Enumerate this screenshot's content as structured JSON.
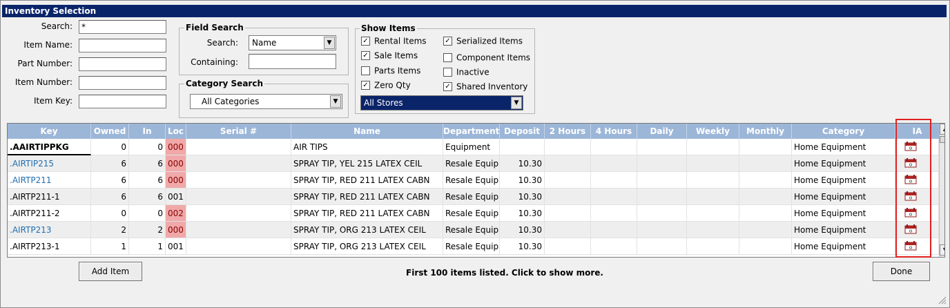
{
  "window": {
    "title": "Inventory Selection"
  },
  "search_fields": {
    "search_label": "Search:",
    "search_value": "*",
    "item_name_label": "Item Name:",
    "item_name_value": "",
    "part_number_label": "Part Number:",
    "part_number_value": "",
    "item_number_label": "Item Number:",
    "item_number_value": "",
    "item_key_label": "Item Key:",
    "item_key_value": ""
  },
  "field_search": {
    "title": "Field Search",
    "search_label": "Search:",
    "search_value": "Name",
    "containing_label": "Containing:",
    "containing_value": ""
  },
  "category_search": {
    "title": "Category Search",
    "value": "All Categories"
  },
  "show_items": {
    "title": "Show Items",
    "options": [
      {
        "label": "Rental Items",
        "checked": true
      },
      {
        "label": "Sale Items",
        "checked": true
      },
      {
        "label": "Parts Items",
        "checked": false
      },
      {
        "label": "Zero Qty",
        "checked": true
      },
      {
        "label": "Serialized Items",
        "checked": true
      },
      {
        "label": "Component Items",
        "checked": false
      },
      {
        "label": "Inactive",
        "checked": false
      },
      {
        "label": "Shared Inventory",
        "checked": true
      }
    ],
    "store_value": "All Stores"
  },
  "grid": {
    "columns": [
      "Key",
      "Owned",
      "In",
      "Loc",
      "Serial #",
      "Name",
      "Department",
      "Deposit",
      "2 Hours",
      "4 Hours",
      "Daily",
      "Weekly",
      "Monthly",
      "Category",
      "IA"
    ],
    "rows": [
      {
        "key": ".AAIRTIPPKG",
        "owned": "0",
        "in": "0",
        "loc": "000",
        "serial": "",
        "name": "AIR TIPS",
        "department": "Equipment",
        "deposit": "",
        "h2": "",
        "h4": "",
        "daily": "",
        "weekly": "",
        "monthly": "",
        "category": "Home Equipment",
        "ia": "calendar-icon"
      },
      {
        "key": ".AIRTIP215",
        "owned": "6",
        "in": "6",
        "loc": "000",
        "serial": "",
        "name": "SPRAY TIP, YEL 215 LATEX CEIL",
        "department": "Resale Equipr",
        "deposit": "10.30",
        "h2": "",
        "h4": "",
        "daily": "",
        "weekly": "",
        "monthly": "",
        "category": "Home Equipment",
        "ia": "calendar-icon"
      },
      {
        "key": ".AIRTP211",
        "owned": "6",
        "in": "6",
        "loc": "000",
        "serial": "",
        "name": "SPRAY TIP, RED 211 LATEX CABN",
        "department": "Resale Equipr",
        "deposit": "10.30",
        "h2": "",
        "h4": "",
        "daily": "",
        "weekly": "",
        "monthly": "",
        "category": "Home Equipment",
        "ia": "calendar-icon"
      },
      {
        "key": ".AIRTP211-1",
        "owned": "6",
        "in": "6",
        "loc": "001",
        "serial": "",
        "name": "SPRAY TIP, RED 211 LATEX CABN",
        "department": "Resale Equipr",
        "deposit": "10.30",
        "h2": "",
        "h4": "",
        "daily": "",
        "weekly": "",
        "monthly": "",
        "category": "Home Equipment",
        "ia": "calendar-icon"
      },
      {
        "key": ".AIRTP211-2",
        "owned": "0",
        "in": "0",
        "loc": "002",
        "serial": "",
        "name": "SPRAY TIP, RED 211 LATEX CABN",
        "department": "Resale Equipr",
        "deposit": "10.30",
        "h2": "",
        "h4": "",
        "daily": "",
        "weekly": "",
        "monthly": "",
        "category": "Home Equipment",
        "ia": "calendar-icon"
      },
      {
        "key": ".AIRTP213",
        "owned": "2",
        "in": "2",
        "loc": "000",
        "serial": "",
        "name": "SPRAY TIP, ORG 213 LATEX CEIL",
        "department": "Resale Equipr",
        "deposit": "10.30",
        "h2": "",
        "h4": "",
        "daily": "",
        "weekly": "",
        "monthly": "",
        "category": "Home Equipment",
        "ia": "calendar-icon"
      },
      {
        "key": ".AIRTP213-1",
        "owned": "1",
        "in": "1",
        "loc": "001",
        "serial": "",
        "name": "SPRAY TIP, ORG 213 LATEX CEIL",
        "department": "Resale Equipr",
        "deposit": "10.30",
        "h2": "",
        "h4": "",
        "daily": "",
        "weekly": "",
        "monthly": "",
        "category": "Home Equipment",
        "ia": "calendar-icon"
      }
    ]
  },
  "footer": {
    "add_item_label": "Add Item",
    "status_text": "First 100 items listed. Click to show more.",
    "done_label": "Done"
  },
  "colors": {
    "title_bar": "#0a246a",
    "header": "#9cb6d8",
    "loc_highlight": "#f0a8a8",
    "link": "#1f6fb2",
    "highlight_box": "#e02020"
  }
}
